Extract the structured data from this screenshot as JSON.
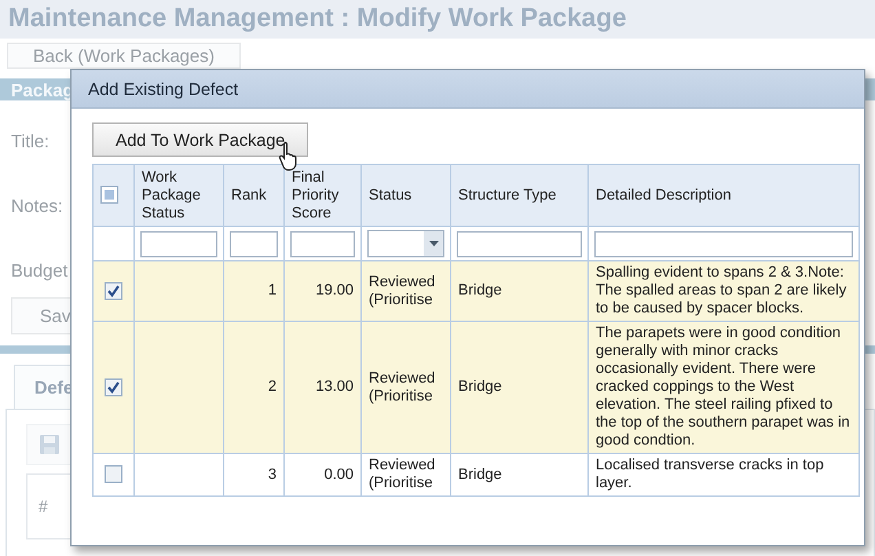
{
  "page": {
    "title": "Maintenance Management : Modify Work Package",
    "back_button": "Back (Work Packages)",
    "section_header": "Packag",
    "fields": [
      "Title:",
      "Notes:",
      "Budget"
    ],
    "save_button": "Sav",
    "tab": "Defe",
    "grid_column": "#"
  },
  "dialog": {
    "title": "Add Existing Defect",
    "add_button": "Add To Work Package",
    "select_all": {
      "partial": true
    },
    "columns": [
      "Work Package Status",
      "Rank",
      "Final Priority Score",
      "Status",
      "Structure Type",
      "Detailed Description"
    ],
    "rows": [
      {
        "checked": true,
        "rank": "1",
        "score": "19.00",
        "status": "Reviewed (Prioritise",
        "structure_type": "Bridge",
        "description": "Spalling evident to spans 2 & 3.Note: The spalled areas to span 2 are likely to be caused by spacer blocks."
      },
      {
        "checked": true,
        "rank": "2",
        "score": "13.00",
        "status": "Reviewed (Prioritise",
        "structure_type": "Bridge",
        "description": "The parapets were in good condition generally with minor cracks occasionally evident. There were cracked coppings to the West elevation. The steel railing pfixed to the top of the southern parapet was in good condtion."
      },
      {
        "checked": false,
        "rank": "3",
        "score": "0.00",
        "status": "Reviewed (Prioritise",
        "structure_type": "Bridge",
        "description": "Localised transverse cracks in top layer."
      }
    ]
  }
}
